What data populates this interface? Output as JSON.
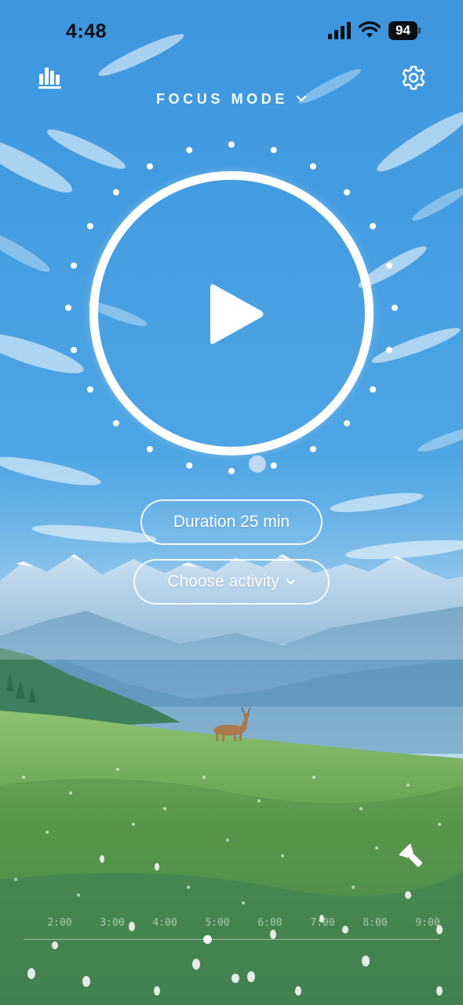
{
  "status_bar": {
    "time": "4:48",
    "battery": "94",
    "icons": [
      "signal-icon",
      "wifi-icon",
      "battery-icon"
    ]
  },
  "header": {
    "mode_label": "FOCUS MODE",
    "left_icon": "stats-bar-chart-icon",
    "right_icon": "gear-icon"
  },
  "timer": {
    "icon": "play-icon"
  },
  "controls": {
    "duration_label": "Duration 25 min",
    "activity_label": "Choose activity"
  },
  "tools": {
    "flashlight_icon": "flashlight-icon"
  },
  "timeline": {
    "ticks": [
      "2:00",
      "3:00",
      "4:00",
      "5:00",
      "6:00",
      "7:00",
      "8:00",
      "9:00"
    ],
    "handle_value": "5:00"
  },
  "colors": {
    "sky_top": "#3f98df",
    "sky_bottom": "#9ccdec",
    "meadow": "#5f9e4c",
    "accent": "#ffffff"
  }
}
